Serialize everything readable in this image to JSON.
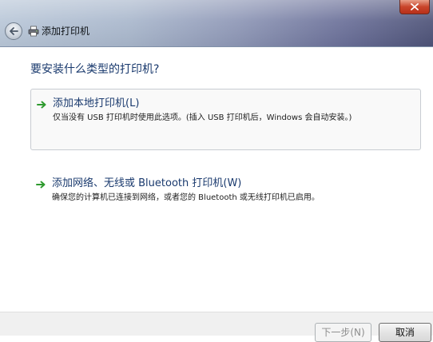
{
  "window": {
    "title": "添加打印机",
    "icons": {
      "back": "back-arrow-icon",
      "printer": "printer-icon",
      "close": "close-icon"
    }
  },
  "main": {
    "heading": "要安装什么类型的打印机?",
    "options": [
      {
        "title": "添加本地打印机(L)",
        "description": "仅当没有 USB 打印机时使用此选项。(插入 USB 打印机后，Windows 会自动安装。)",
        "icon": "green-arrow-icon",
        "selected": true
      },
      {
        "title": "添加网络、无线或 Bluetooth 打印机(W)",
        "description": "确保您的计算机已连接到网络，或者您的 Bluetooth 或无线打印机已启用。",
        "icon": "green-arrow-icon",
        "selected": false
      }
    ]
  },
  "footer": {
    "next_label": "下一步(N)",
    "cancel_label": "取消"
  },
  "colors": {
    "heading": "#1a3a6e",
    "arrow": "#2e9a2e",
    "close": "#c9452b"
  }
}
